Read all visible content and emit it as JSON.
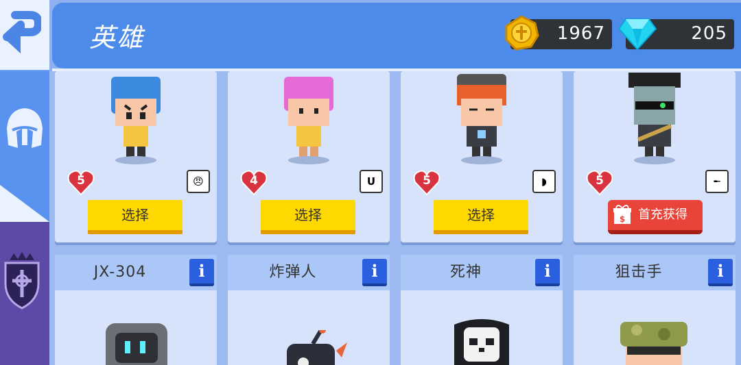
{
  "header": {
    "title": "英雄",
    "coins": "1967",
    "gems": "205"
  },
  "colors": {
    "header_bg": "#4d8bea",
    "select_button": "#ffd800",
    "buy_button": "#e8443a",
    "info_button": "#2a5fe0",
    "level_heart": "#d8333e"
  },
  "nav": {
    "back": "back-arrow-icon",
    "hero_tab": "helmet-icon",
    "guild_tab": "crowned-shield-icon"
  },
  "owned_heroes": [
    {
      "level": "5",
      "skill_icon": "angry-face-icon",
      "skill_glyph": "😠",
      "action": "选择"
    },
    {
      "level": "4",
      "skill_icon": "magnet-icon",
      "skill_glyph": "U",
      "action": "选择"
    },
    {
      "level": "5",
      "skill_icon": "shield-icon",
      "skill_glyph": "◗",
      "action": "选择"
    },
    {
      "level": "5",
      "skill_icon": "rifle-icon",
      "skill_glyph": "╾",
      "action": "首充获得"
    }
  ],
  "locked_heroes": [
    {
      "name": "JX-304",
      "info": "i"
    },
    {
      "name": "炸弹人",
      "info": "i"
    },
    {
      "name": "死神",
      "info": "i"
    },
    {
      "name": "狙击手",
      "info": "i"
    }
  ]
}
